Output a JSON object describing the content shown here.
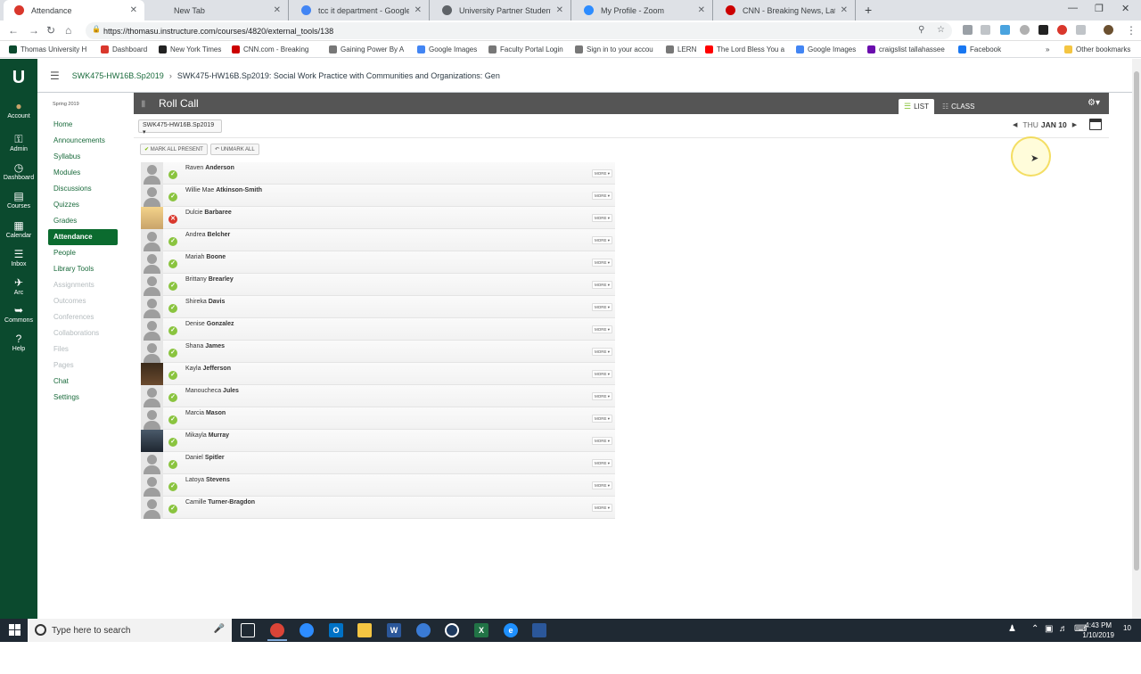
{
  "browser": {
    "tabs": [
      {
        "title": "Attendance",
        "color": "#d9372c"
      },
      {
        "title": "New Tab",
        "color": ""
      },
      {
        "title": "tcc it department - Google Search",
        "color": "#4285f4"
      },
      {
        "title": "University Partner Students - Tallahassee",
        "color": "#5f6368"
      },
      {
        "title": "My Profile - Zoom",
        "color": "#2d8cff"
      },
      {
        "title": "CNN - Breaking News, Latest News",
        "color": "#cc0000"
      }
    ],
    "new_tab_symbol": "+",
    "url": "https://thomasu.instructure.com/courses/4820/external_tools/138",
    "bookmarks": [
      {
        "label": "Thomas University H",
        "color": "#0b4a2e"
      },
      {
        "label": "Dashboard",
        "color": "#d9372c"
      },
      {
        "label": "New York Times",
        "color": "#222"
      },
      {
        "label": "CNN.com - Breaking",
        "color": "#cc0000"
      },
      {
        "label": "Gaining Power By A",
        "color": "#777"
      },
      {
        "label": "Google Images",
        "color": "#4285f4"
      },
      {
        "label": "Faculty Portal Login",
        "color": "#777"
      },
      {
        "label": "Sign in to your accou",
        "color": "#777"
      },
      {
        "label": "LERN",
        "color": "#777"
      },
      {
        "label": "The Lord Bless You a",
        "color": "#ff0000"
      },
      {
        "label": "Google Images",
        "color": "#4285f4"
      },
      {
        "label": "craigslist tallahassee",
        "color": "#6a0dad"
      },
      {
        "label": "Facebook",
        "color": "#1877f2"
      }
    ],
    "bookmarks_overflow": "»",
    "other_bookmarks": "Other bookmarks"
  },
  "global_nav": {
    "logo": "U",
    "items": [
      {
        "label": "Account",
        "icon": "account-icon"
      },
      {
        "label": "Admin",
        "icon": "admin-icon"
      },
      {
        "label": "Dashboard",
        "icon": "dashboard-icon"
      },
      {
        "label": "Courses",
        "icon": "courses-icon"
      },
      {
        "label": "Calendar",
        "icon": "calendar-icon"
      },
      {
        "label": "Inbox",
        "icon": "inbox-icon"
      },
      {
        "label": "Arc",
        "icon": "arc-icon"
      },
      {
        "label": "Commons",
        "icon": "commons-icon"
      },
      {
        "label": "Help",
        "icon": "help-icon"
      }
    ]
  },
  "breadcrumb": {
    "course_code": "SWK475-HW16B.Sp2019",
    "course_name": "SWK475-HW16B.Sp2019: Social Work Practice with Communities and Organizations: Gen"
  },
  "course_nav": {
    "term": "Spring 2019",
    "items": [
      {
        "label": "Home",
        "state": "normal"
      },
      {
        "label": "Announcements",
        "state": "normal"
      },
      {
        "label": "Syllabus",
        "state": "normal"
      },
      {
        "label": "Modules",
        "state": "normal"
      },
      {
        "label": "Discussions",
        "state": "normal"
      },
      {
        "label": "Quizzes",
        "state": "normal"
      },
      {
        "label": "Grades",
        "state": "normal"
      },
      {
        "label": "Attendance",
        "state": "active"
      },
      {
        "label": "People",
        "state": "normal"
      },
      {
        "label": "Library Tools",
        "state": "normal"
      },
      {
        "label": "Assignments",
        "state": "disabled"
      },
      {
        "label": "Outcomes",
        "state": "disabled"
      },
      {
        "label": "Conferences",
        "state": "disabled"
      },
      {
        "label": "Collaborations",
        "state": "disabled"
      },
      {
        "label": "Files",
        "state": "disabled"
      },
      {
        "label": "Pages",
        "state": "disabled"
      },
      {
        "label": "Chat",
        "state": "normal"
      },
      {
        "label": "Settings",
        "state": "normal"
      }
    ]
  },
  "roll_call": {
    "title": "Roll Call",
    "view_list": "LIST",
    "view_class": "CLASS",
    "section": "SWK475-HW16B.Sp2019",
    "day": "THU",
    "date": "JAN 10",
    "mark_all_present": "MARK ALL PRESENT",
    "unmark_all": "UNMARK ALL",
    "more_label": "MORE",
    "students": [
      {
        "first": "Raven",
        "last": "Anderson",
        "status": "present",
        "avatar": "default"
      },
      {
        "first": "Willie Mae",
        "last": "Atkinson-Smith",
        "status": "present",
        "avatar": "default"
      },
      {
        "first": "Dulcie",
        "last": "Barbaree",
        "status": "absent",
        "avatar": "photo1"
      },
      {
        "first": "Andrea",
        "last": "Belcher",
        "status": "present",
        "avatar": "default"
      },
      {
        "first": "Mariah",
        "last": "Boone",
        "status": "present",
        "avatar": "default"
      },
      {
        "first": "Brittany",
        "last": "Brearley",
        "status": "present",
        "avatar": "default"
      },
      {
        "first": "Shireka",
        "last": "Davis",
        "status": "present",
        "avatar": "default"
      },
      {
        "first": "Denise",
        "last": "Gonzalez",
        "status": "present",
        "avatar": "default"
      },
      {
        "first": "Shana",
        "last": "James",
        "status": "present",
        "avatar": "default"
      },
      {
        "first": "Kayla",
        "last": "Jefferson",
        "status": "present",
        "avatar": "photo2"
      },
      {
        "first": "Manoucheca",
        "last": "Jules",
        "status": "present",
        "avatar": "default"
      },
      {
        "first": "Marcia",
        "last": "Mason",
        "status": "present",
        "avatar": "default"
      },
      {
        "first": "Mikayla",
        "last": "Murray",
        "status": "present",
        "avatar": "photo3"
      },
      {
        "first": "Daniel",
        "last": "Spitler",
        "status": "present",
        "avatar": "default"
      },
      {
        "first": "Latoya",
        "last": "Stevens",
        "status": "present",
        "avatar": "default"
      },
      {
        "first": "Camille",
        "last": "Turner-Bragdon",
        "status": "present",
        "avatar": "default"
      }
    ]
  },
  "taskbar": {
    "search_placeholder": "Type here to search",
    "time": "4:43 PM",
    "date": "1/10/2019",
    "notifications": "10"
  }
}
